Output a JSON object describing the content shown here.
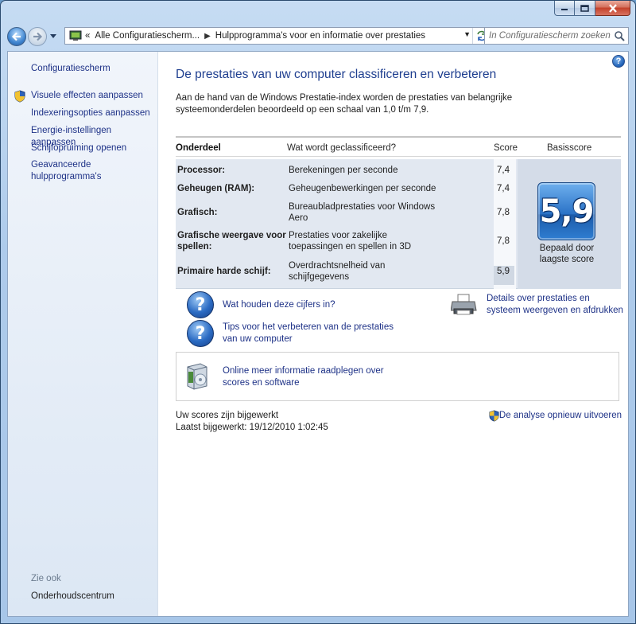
{
  "window": {
    "caption_buttons": [
      "minimize",
      "maximize",
      "close"
    ]
  },
  "navigation": {
    "address": {
      "overflow": "«",
      "segments": [
        "Alle Configuratiescherm...",
        "Hulpprogramma's voor en informatie over prestaties"
      ]
    },
    "search": {
      "placeholder": "In Configuratiescherm zoeken"
    }
  },
  "sidebar": {
    "home": "Configuratiescherm",
    "items": [
      {
        "label": "Visuele effecten aanpassen",
        "icon": "uac-shield-icon"
      },
      {
        "label": "Indexeringsopties aanpassen"
      },
      {
        "label": "Energie-instellingen aanpassen"
      },
      {
        "label": "Schijfopruiming openen"
      },
      {
        "label": "Geavanceerde hulpprogramma's"
      }
    ],
    "see_also": {
      "heading": "Zie ook",
      "items": [
        "Onderhoudscentrum"
      ]
    }
  },
  "main": {
    "title": "De prestaties van uw computer classificeren en verbeteren",
    "intro": "Aan de hand van de Windows Prestatie-index worden de prestaties van belangrijke systeemonderdelen beoordeeld op een schaal van 1,0 t/m 7,9.",
    "table": {
      "headers": {
        "component": "Onderdeel",
        "rated": "Wat wordt geclassificeerd?",
        "score": "Score",
        "base": "Basisscore"
      },
      "rows": [
        {
          "component": "Processor:",
          "rated": "Berekeningen per seconde",
          "score": "7,4"
        },
        {
          "component": "Geheugen (RAM):",
          "rated": "Geheugenbewerkingen per seconde",
          "score": "7,4"
        },
        {
          "component": "Grafisch:",
          "rated": "Bureaubladprestaties voor Windows Aero",
          "score": "7,8"
        },
        {
          "component": "Grafische weergave voor spellen:",
          "rated": "Prestaties voor zakelijke toepassingen en spellen in 3D",
          "score": "7,8"
        },
        {
          "component": "Primaire harde schijf:",
          "rated": "Overdrachtsnelheid van schijfgegevens",
          "score": "5,9"
        }
      ],
      "base_score": "5,9",
      "base_caption": "Bepaald door laagste score"
    },
    "links": {
      "numbers_meaning": "Wat houden deze cijfers in?",
      "tips": "Tips voor het verbeteren van de prestaties van uw computer",
      "details_print": "Details over prestaties en systeem weergeven en afdrukken",
      "online_info": "Online meer informatie raadplegen over scores en software"
    },
    "status": {
      "updated": "Uw scores zijn bijgewerkt",
      "last_updated": "Laatst bijgewerkt: 19/12/2010 1:02:45"
    },
    "rerun": "De analyse opnieuw uitvoeren"
  },
  "colors": {
    "link": "#1e3287",
    "title": "#1e3e8f",
    "badge": "#2a72c6"
  }
}
